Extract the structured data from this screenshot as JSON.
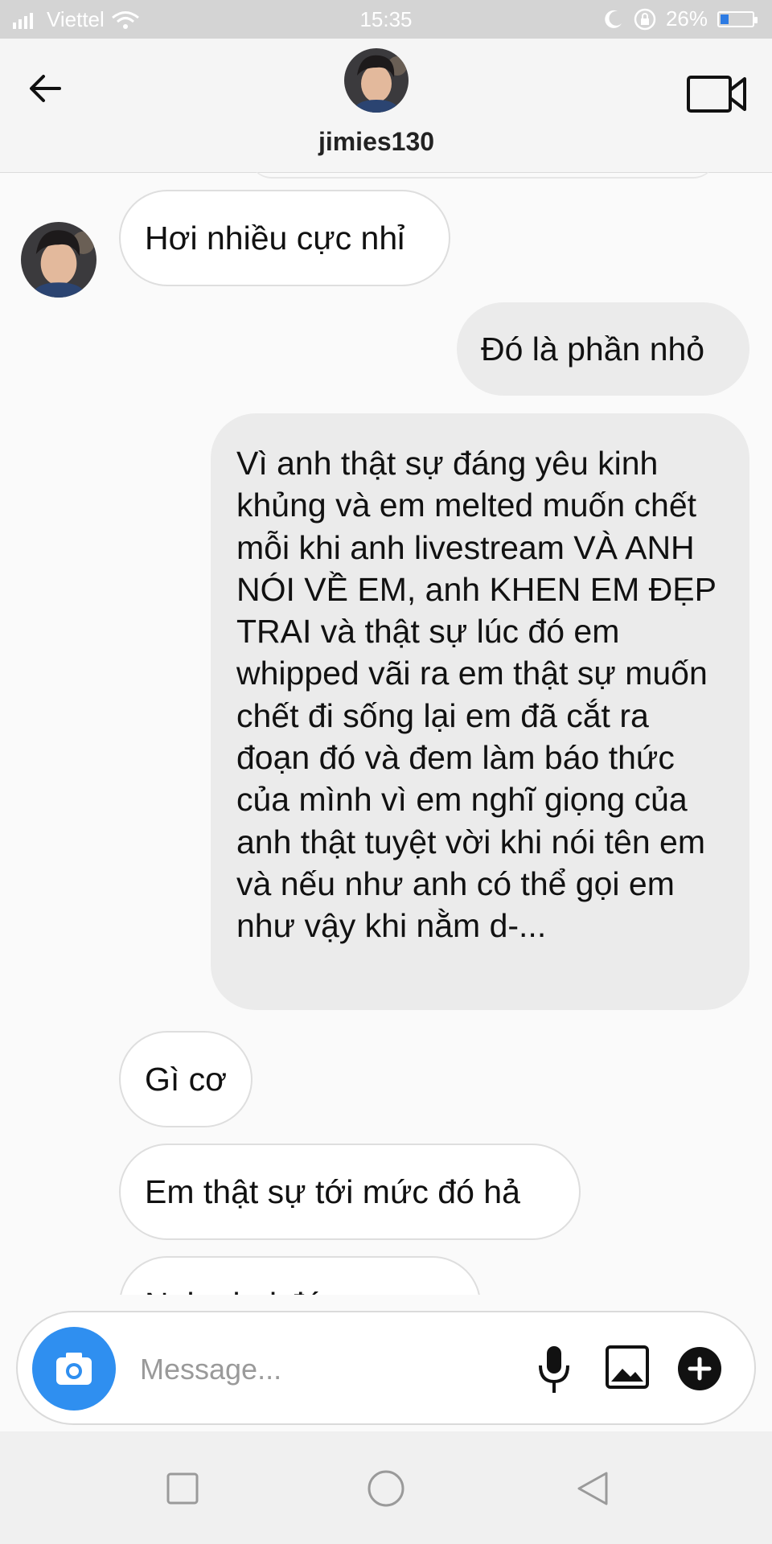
{
  "status": {
    "carrier": "Viettel",
    "time": "15:35",
    "battery": "26%",
    "battery_level": 0.26
  },
  "header": {
    "username": "jimies130"
  },
  "messages": [
    {
      "side": "in",
      "text": "Hơi nhiều cực nhỉ"
    },
    {
      "side": "out",
      "text": "Đó là phần nhỏ"
    },
    {
      "side": "out",
      "text": "Vì anh thật sự đáng yêu kinh khủng và em melted muốn chết mỗi khi anh livestream VÀ ANH NÓI VỀ EM, anh KHEN EM ĐẸP TRAI và thật sự lúc đó em whipped vãi ra em thật sự muốn chết đi sống lại em đã cắt ra đoạn đó và đem làm báo thức của mình vì em nghĩ giọng của anh thật tuyệt vời khi nói tên em và nếu như anh có thể gọi em như vậy khi nằm d-..."
    },
    {
      "side": "in",
      "text": "Gì cơ"
    },
    {
      "side": "in",
      "text": "Em thật sự tới mức đó hả"
    },
    {
      "side": "in",
      "text": "Nghe hai đó"
    }
  ],
  "composer": {
    "placeholder": "Message..."
  },
  "colors": {
    "accent": "#2f8ff0",
    "incoming_bubble": "#ffffff",
    "outgoing_bubble": "#ebebeb",
    "status_bar": "#d4d4d4"
  },
  "icons": {
    "back": "arrow-left-icon",
    "video": "video-camera-icon",
    "camera": "camera-icon",
    "mic": "microphone-icon",
    "gallery": "image-icon",
    "plus": "plus-circle-icon"
  }
}
